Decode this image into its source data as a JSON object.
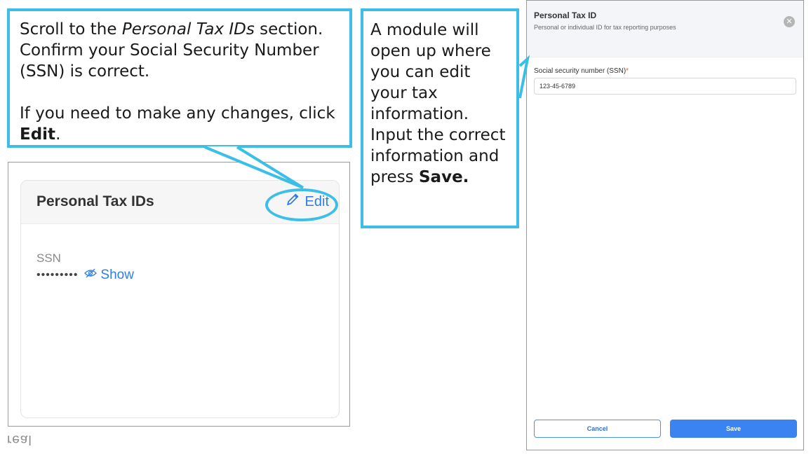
{
  "colors": {
    "callout_border": "#3bbfe6",
    "link_blue": "#2f7fe0",
    "save_blue": "#3a83f0"
  },
  "callout1": {
    "pre_italic": "Scroll to the ",
    "italic": "Personal Tax IDs",
    "post_italic": " section. Confirm your Social Security Number (SSN) is correct.",
    "line2_pre": "If you need to make any changes, click ",
    "line2_bold": "Edit",
    "line2_post": "."
  },
  "callout2": {
    "text": "A module will open up where you can edit your tax information. Input the correct information and press ",
    "bold": "Save."
  },
  "card": {
    "title": "Personal Tax IDs",
    "edit_label": "Edit",
    "edit_icon": "pencil-icon",
    "ssn_label": "SSN",
    "ssn_masked": "•••••••••",
    "show_label": "Show",
    "show_icon": "eye-off-icon"
  },
  "logo": "real",
  "modal": {
    "title": "Personal Tax ID",
    "subtitle": "Personal or individual ID for tax reporting purposes",
    "close_icon": "close-icon",
    "ssn_field_label": "Social security number (SSN)",
    "required_mark": "*",
    "ssn_value": "123-45-6789",
    "cancel_label": "Cancel",
    "save_label": "Save"
  }
}
